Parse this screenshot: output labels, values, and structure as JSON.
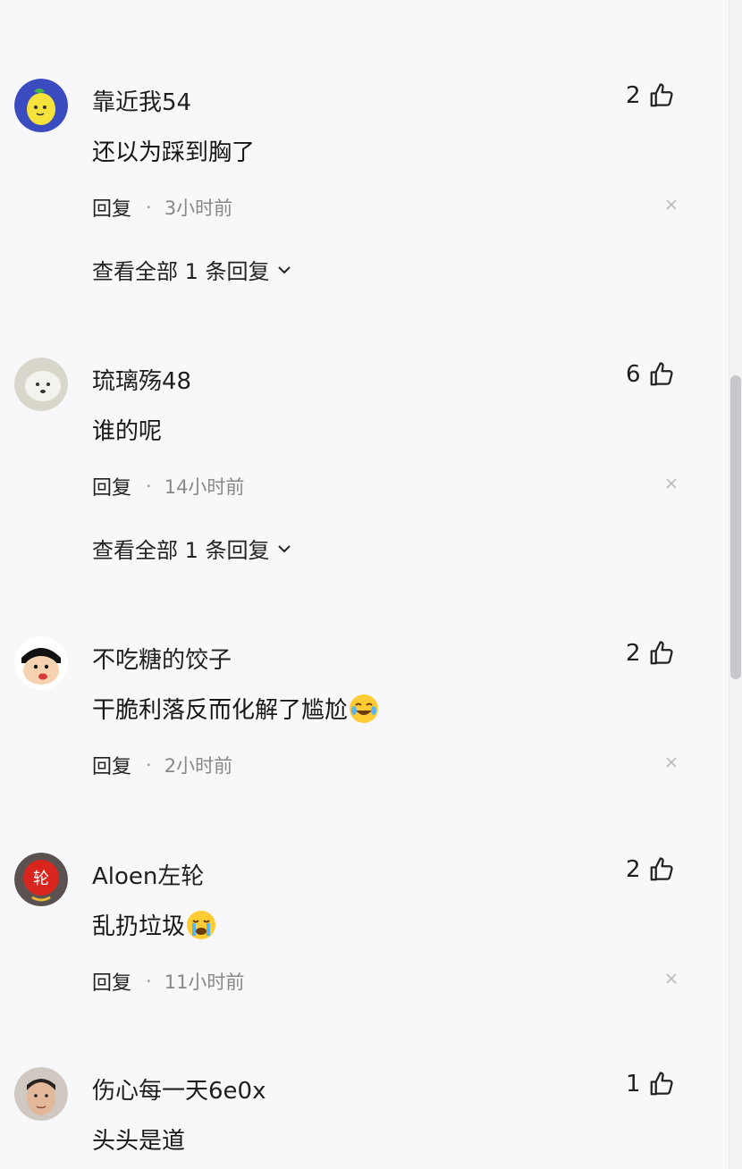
{
  "comments": [
    {
      "user": "靠近我54",
      "text": "还以为踩到胸了",
      "likes": "2",
      "reply_label": "回复",
      "separator": "·",
      "time": "3小时前",
      "expand": "查看全部 1 条回复",
      "avatar_icon": "lemon-cartoon-avatar"
    },
    {
      "user": "琉璃殇48",
      "text": "谁的呢",
      "likes": "6",
      "reply_label": "回复",
      "separator": "·",
      "time": "14小时前",
      "expand": "查看全部 1 条回复",
      "avatar_icon": "white-dog-avatar"
    },
    {
      "user": "不吃糖的饺子",
      "text": "干脆利落反而化解了尴尬",
      "likes": "2",
      "reply_label": "回复",
      "separator": "·",
      "time": "2小时前",
      "emoji": "laughing-tears-emoji",
      "avatar_icon": "cartoon-boy-avatar"
    },
    {
      "user": "Aloen左轮",
      "text": "乱扔垃圾",
      "likes": "2",
      "reply_label": "回复",
      "separator": "·",
      "time": "11小时前",
      "emoji": "crying-emoji",
      "avatar_icon": "red-seal-avatar"
    },
    {
      "user": "伤心每一天6e0x",
      "text": "头头是道",
      "likes": "1",
      "avatar_icon": "man-photo-avatar"
    }
  ],
  "colors": {
    "background": "#f8f8fa",
    "text": "#161616",
    "muted": "#888888"
  }
}
